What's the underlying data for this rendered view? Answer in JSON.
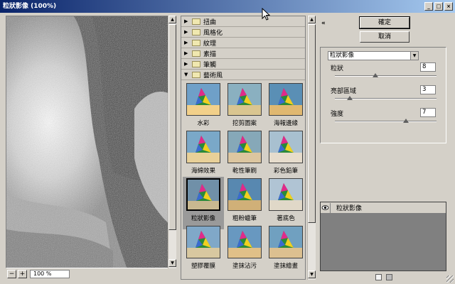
{
  "window": {
    "title": "粒狀影像 (100%)"
  },
  "preview": {
    "zoom": "100 %",
    "zoom_out": "−",
    "zoom_in": "+"
  },
  "categories": [
    {
      "label": "扭曲",
      "expanded": false
    },
    {
      "label": "風格化",
      "expanded": false
    },
    {
      "label": "紋理",
      "expanded": false
    },
    {
      "label": "素描",
      "expanded": false
    },
    {
      "label": "筆觸",
      "expanded": false
    },
    {
      "label": "藝術風",
      "expanded": true
    }
  ],
  "filters": [
    {
      "label": "水彩"
    },
    {
      "label": "挖剪圖案"
    },
    {
      "label": "海報邊緣"
    },
    {
      "label": "海綿效果"
    },
    {
      "label": "乾性筆刷"
    },
    {
      "label": "彩色鉛筆"
    },
    {
      "label": "粒狀影像",
      "selected": true
    },
    {
      "label": "粗粉蠟筆"
    },
    {
      "label": "著底色"
    },
    {
      "label": "塑膠覆膜"
    },
    {
      "label": "塗抹沾污"
    },
    {
      "label": "塗抹繪畫"
    }
  ],
  "buttons": {
    "ok": "確定",
    "cancel": "取消"
  },
  "filter_select": {
    "value": "粒狀影像"
  },
  "params": [
    {
      "label": "粒狀",
      "value": "8",
      "level": 0.4
    },
    {
      "label": "亮部區域",
      "value": "3",
      "level": 0.15
    },
    {
      "label": "強度",
      "value": "7",
      "level": 0.7
    }
  ],
  "layers": [
    {
      "name": "粒狀影像"
    }
  ],
  "colors": {
    "title_start": "#0a246a",
    "title_end": "#a6caf0",
    "panel": "#d4d0c8",
    "layer_bg": "#808080"
  }
}
